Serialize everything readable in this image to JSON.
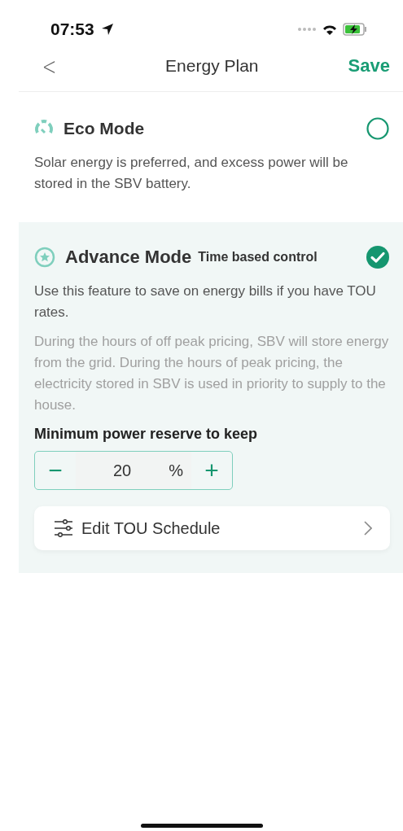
{
  "status_bar": {
    "time": "07:53"
  },
  "nav": {
    "back": "<",
    "title": "Energy Plan",
    "action": "Save"
  },
  "modes": [
    {
      "kind": "eco",
      "title": "Eco Mode",
      "selected": false,
      "description": "Solar energy is preferred, and excess power will be stored in the SBV battery."
    },
    {
      "kind": "advance",
      "title": "Advance Mode",
      "subtitle": "Time based control",
      "selected": true,
      "description": "Use this feature to save on energy bills if you have TOU rates.",
      "note": "During the hours of off peak pricing, SBV will store energy from the grid. During the hours of peak pricing, the electricity stored in SBV is used in priority to supply to the house.",
      "reserve": {
        "label": "Minimum power reserve to keep",
        "minus": "−",
        "value": "20",
        "unit": "%",
        "plus": "+"
      },
      "link": "Edit TOU Schedule"
    }
  ]
}
